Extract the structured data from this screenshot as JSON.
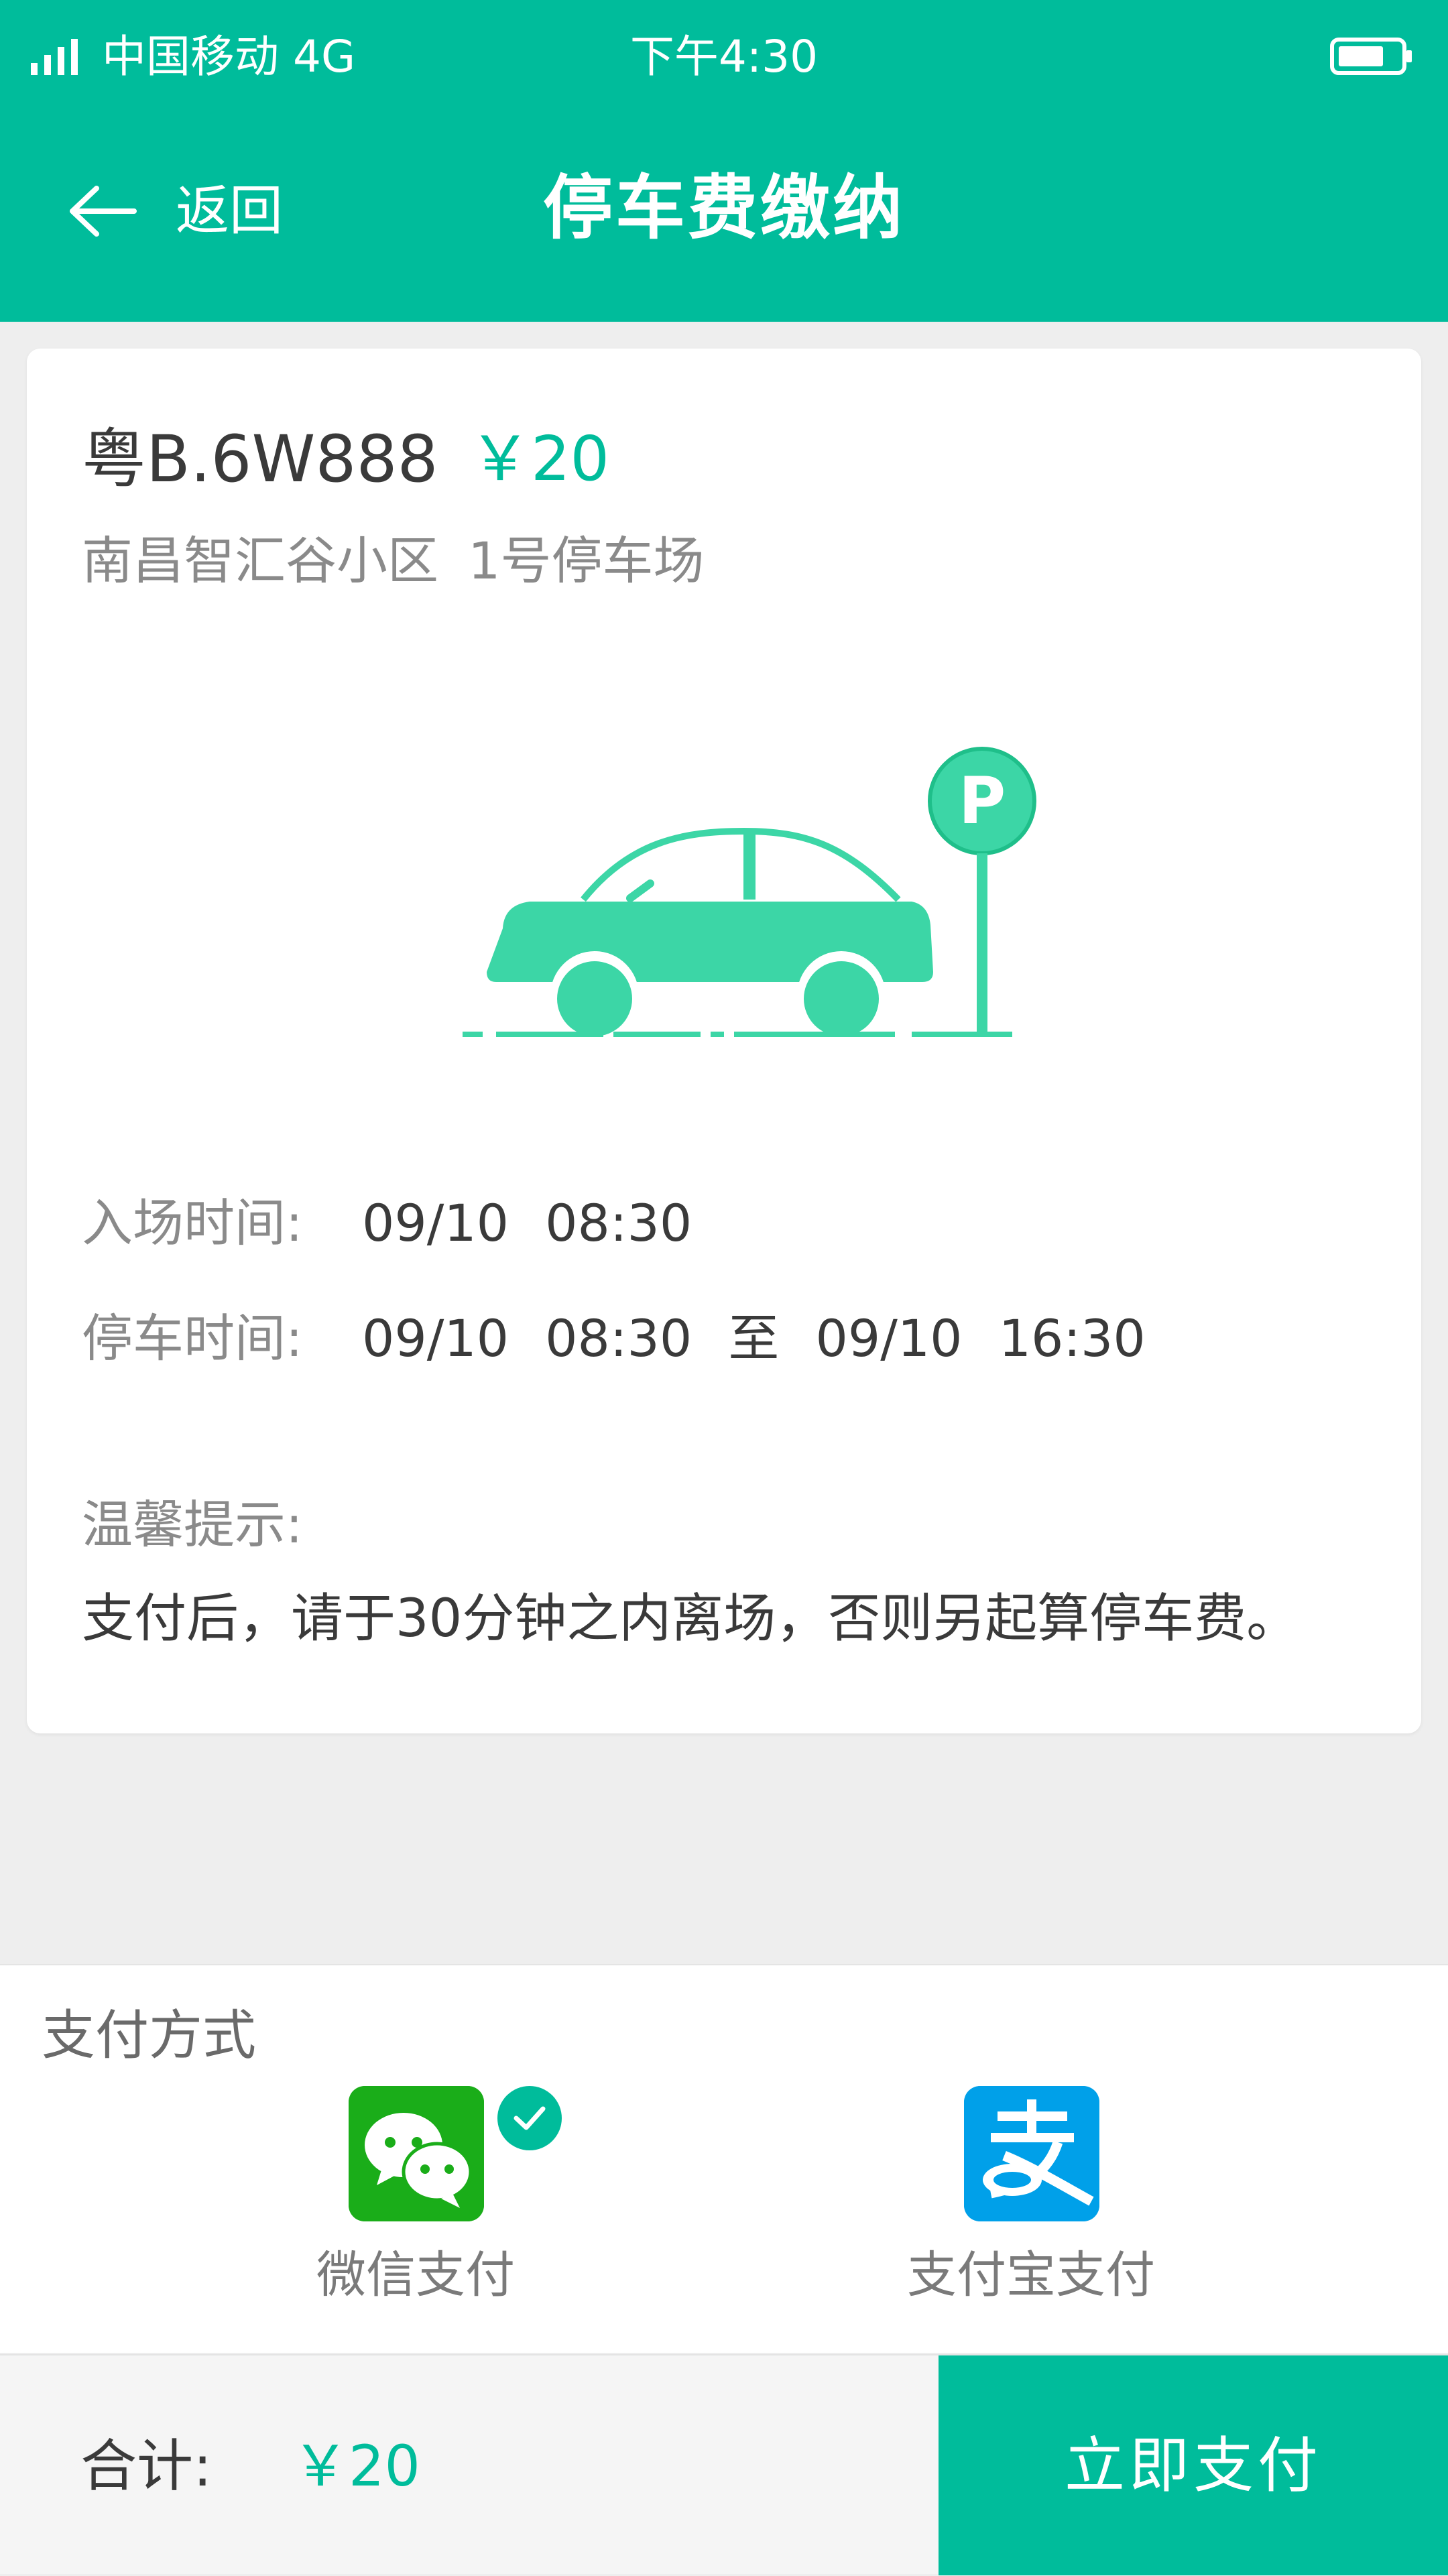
{
  "status_bar": {
    "carrier": "中国移动  4G",
    "time": "下午4:30"
  },
  "nav": {
    "back_label": "返回",
    "title": "停车费缴纳"
  },
  "order": {
    "plate": "粤B.6W888",
    "amount": "￥20",
    "location": "南昌智汇谷小区  1号停车场",
    "entry_label": "入场时间:",
    "entry_value": "09/10  08:30",
    "parking_label": "停车时间:",
    "parking_value": "09/10  08:30  至  09/10  16:30",
    "tip_title": "温馨提示:",
    "tip_text": "支付后，请于30分钟之内离场，否则另起算停车费。",
    "illustration_icon": "car-parking-icon"
  },
  "payment": {
    "title": "支付方式",
    "options": [
      {
        "label": "微信支付",
        "icon": "wechat-pay-icon",
        "selected": true
      },
      {
        "label": "支付宝支付",
        "icon": "alipay-icon",
        "selected": false
      }
    ]
  },
  "footer": {
    "total_label": "合计:",
    "total_value": "￥20",
    "pay_button": "立即支付"
  },
  "colors": {
    "accent": "#00bc9b",
    "illustration": "#3cd6a6",
    "wechat": "#1aad19",
    "alipay": "#00a0e9"
  }
}
